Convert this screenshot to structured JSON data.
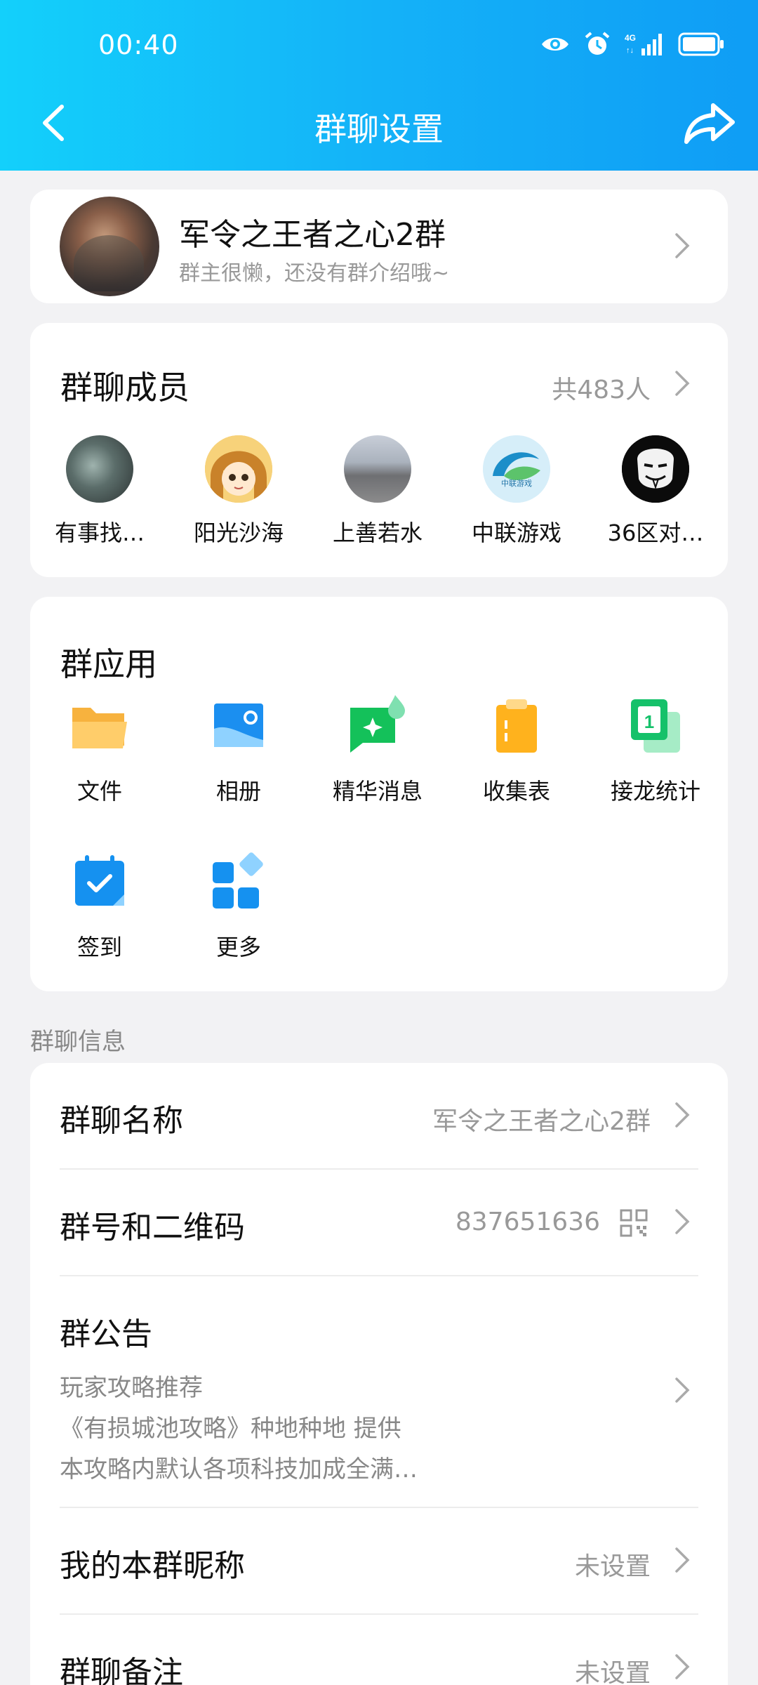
{
  "status": {
    "time": "00:40"
  },
  "header": {
    "title": "群聊设置"
  },
  "group": {
    "name": "军令之王者之心2群",
    "description": "群主很懒，还没有群介绍哦~"
  },
  "members": {
    "title": "群聊成员",
    "count": "共483人",
    "list": [
      {
        "name": "有事找…"
      },
      {
        "name": "阳光沙海"
      },
      {
        "name": "上善若水"
      },
      {
        "name": "中联游戏",
        "avatar_text": "中联游戏"
      },
      {
        "name": "36区对…"
      }
    ]
  },
  "apps": {
    "title": "群应用",
    "items": [
      {
        "label": "文件",
        "icon": "folder-icon"
      },
      {
        "label": "相册",
        "icon": "album-icon"
      },
      {
        "label": "精华消息",
        "icon": "essence-message-icon"
      },
      {
        "label": "收集表",
        "icon": "clipboard-icon"
      },
      {
        "label": "接龙统计",
        "icon": "relay-icon"
      },
      {
        "label": "签到",
        "icon": "calendar-check-icon"
      },
      {
        "label": "更多",
        "icon": "more-apps-icon"
      }
    ]
  },
  "info": {
    "section_label": "群聊信息",
    "group_name": {
      "label": "群聊名称",
      "value": "军令之王者之心2群"
    },
    "group_number": {
      "label": "群号和二维码",
      "value": "837651636"
    },
    "notice": {
      "label": "群公告",
      "lines": [
        "玩家攻略推荐",
        "《有损城池攻略》种地种地 提供",
        "本攻略内默认各项科技加成全满…"
      ]
    },
    "nickname": {
      "label": "我的本群昵称",
      "value": "未设置"
    },
    "remark": {
      "label": "群聊备注",
      "value": "未设置"
    }
  },
  "colors": {
    "header_start": "#13d0fb",
    "header_end": "#0f9df5",
    "accent": "#0f9df5"
  }
}
